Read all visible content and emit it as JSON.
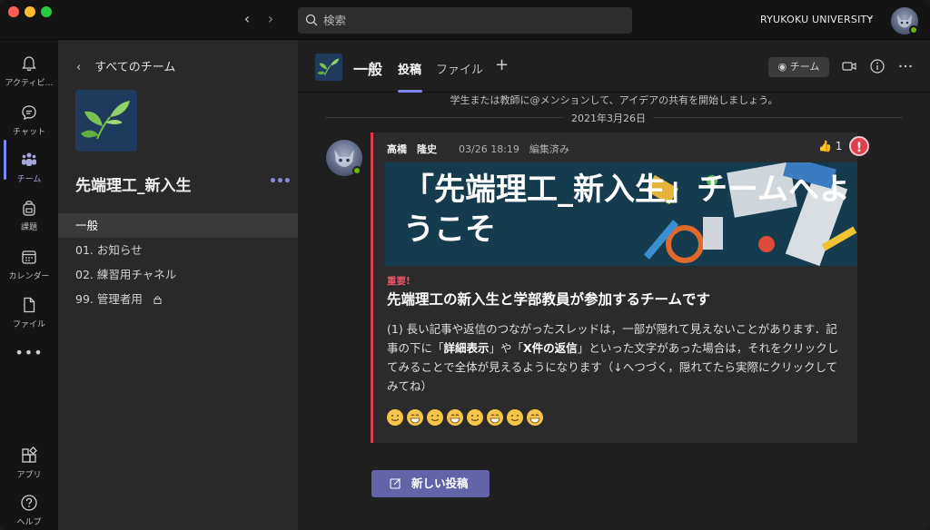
{
  "search": {
    "placeholder": "検索"
  },
  "org": {
    "name": "RYUKOKU UNIVERSITY"
  },
  "rail": {
    "items": [
      {
        "label": "アクティビ…",
        "icon": "bell-icon"
      },
      {
        "label": "チャット",
        "icon": "chat-icon"
      },
      {
        "label": "チーム",
        "icon": "teams-icon"
      },
      {
        "label": "課題",
        "icon": "backpack-icon"
      },
      {
        "label": "カレンダー",
        "icon": "calendar-icon"
      },
      {
        "label": "ファイル",
        "icon": "file-icon"
      }
    ],
    "more": "•••",
    "apps_label": "アプリ",
    "help_label": "ヘルプ"
  },
  "teampane": {
    "back_label": "すべてのチーム",
    "team_name": "先端理工_新入生",
    "more": "•••",
    "channels": [
      {
        "name": "一般",
        "active": true
      },
      {
        "name": "01. お知らせ"
      },
      {
        "name": "02. 練習用チャネル"
      },
      {
        "name": "99. 管理者用",
        "locked": true
      }
    ]
  },
  "header": {
    "channel_name": "一般",
    "tabs": [
      {
        "label": "投稿",
        "active": true
      },
      {
        "label": "ファイル"
      }
    ],
    "add_tab": "+",
    "team_button": "チーム"
  },
  "thread": {
    "hint": "学生または教師に@メンションして、アイデアの共有を開始しましょう。",
    "date": "2021年3月26日",
    "post": {
      "author": "高橋　隆史",
      "meta": "03/26 18:19　編集済み",
      "reaction_count": "1",
      "banner_title": "「先端理工_新入生」チームへようこそ",
      "important_label": "重要!",
      "subject": "先端理工の新入生と学部教員が参加するチームです",
      "body_parts": [
        "(1) 長い記事や返信のつながったスレッドは，一部が隠れて見えないことがあります．記事の下に「",
        "詳細表示",
        "」や「",
        "X件の返信",
        "」といった文字があった場合は，それをクリックしてみることで全体が見えるようになります（↓へつづく，隠れてたら実際にクリックしてみてね）"
      ],
      "emoji_count": 8
    },
    "new_post_label": "新しい投稿"
  },
  "colors": {
    "accent": "#7f85f5",
    "button": "#6264a7",
    "important": "#e03e4e",
    "presence": "#6bb700"
  }
}
